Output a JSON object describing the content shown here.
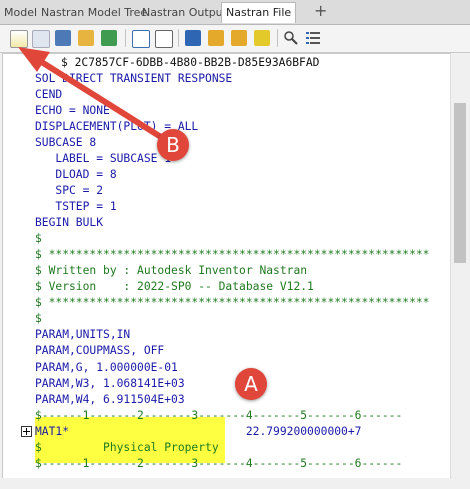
{
  "tabs": [
    {
      "label": "Model"
    },
    {
      "label": "Nastran Model Tree"
    },
    {
      "label": "Nastran Output"
    },
    {
      "label": "Nastran File",
      "active": true
    }
  ],
  "tab_add_icon": "plus-icon",
  "toolbar_icons": [
    "new-file-icon",
    "settings-icon",
    "save-icon",
    "import-icon",
    "export-icon",
    "table-icon",
    "grid-icon",
    "bookmark-icon",
    "bookmark-next-icon",
    "bookmark-prev-icon",
    "bookmark-clear-icon",
    "find-icon",
    "list-icon"
  ],
  "editor": {
    "lines": [
      "$ 2C7857CF-6DBB-4B80-BB2B-D85E93A6BFAD",
      "SOL DIRECT TRANSIENT RESPONSE",
      "CEND",
      "ECHO = NONE",
      "DISPLACEMENT(PLOT) = ALL",
      "SUBCASE 8",
      "   LABEL = SUBCASE 1",
      "   DLOAD = 8",
      "   SPC = 2",
      "   TSTEP = 1",
      "BEGIN BULK",
      "$",
      "$ ********************************************************",
      "$ Written by : Autodesk Inventor Nastran",
      "$ Version    : 2022-SP0 -- Database V12.1",
      "$ ********************************************************",
      "$",
      "PARAM,UNITS,IN",
      "PARAM,COUPMASS, OFF",
      "PARAM,G, 1.000000E-01",
      "PARAM,W3, 1.068141E+03",
      "PARAM,W4, 6.911504E+03",
      "$------1-------2-------3-------4-------5-------6------",
      "MAT1*                          22.799200000000+7",
      "$         Physical Property",
      "$------1-------2-------3-------4-------5-------6------"
    ]
  },
  "callouts": {
    "a": "A",
    "b": "B"
  },
  "colors": {
    "highlight": "#ffff42",
    "callout": "#e0463a",
    "keyword": "#1a1aa8",
    "comment": "#1f7a1f"
  }
}
